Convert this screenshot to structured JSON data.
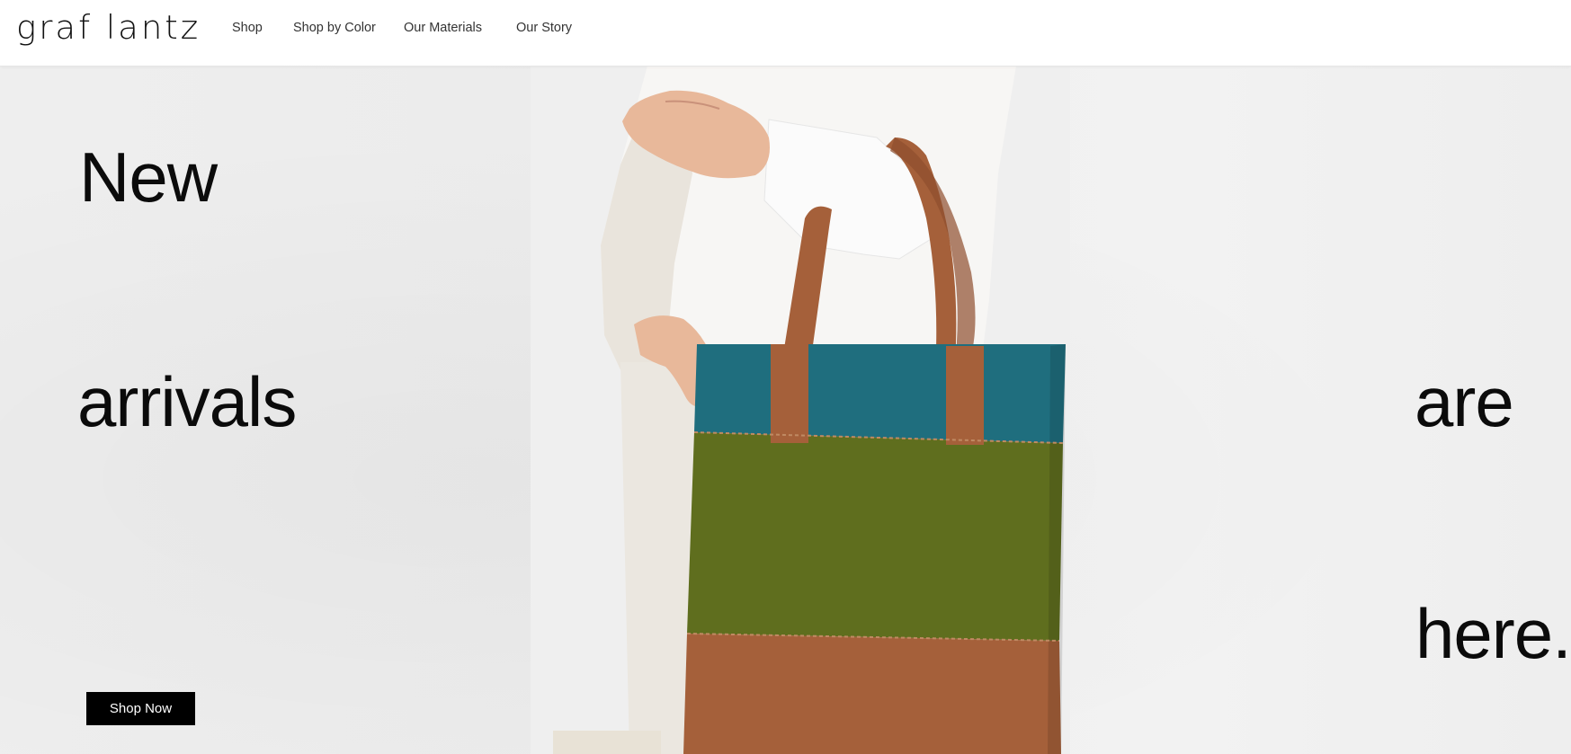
{
  "brand": {
    "logo_text": "graf lantz"
  },
  "nav": {
    "items": [
      {
        "label": "Shop"
      },
      {
        "label": "Shop by Color"
      },
      {
        "label": "Our Materials"
      },
      {
        "label": "Our Story"
      }
    ]
  },
  "hero": {
    "words": [
      "New",
      "arrivals",
      "are",
      "here."
    ],
    "cta_label": "Shop Now"
  },
  "colors": {
    "text": "#0b0b0b",
    "cta_bg": "#000000",
    "cta_text": "#ffffff",
    "bag_teal": "#1f6e7e",
    "bag_green": "#5f6e1e",
    "bag_leather": "#a5603a"
  }
}
